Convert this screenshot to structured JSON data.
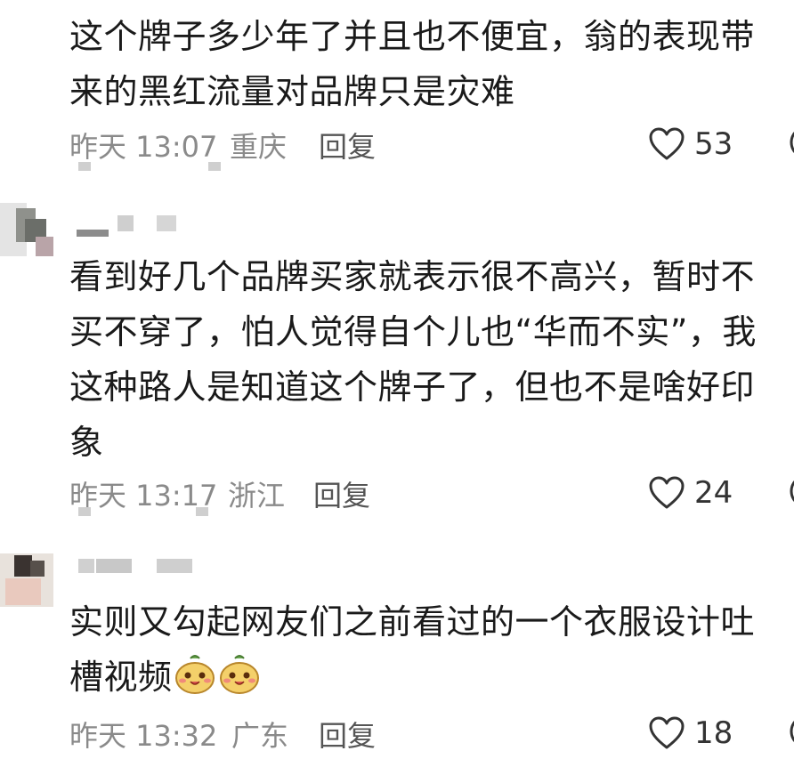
{
  "comments": [
    {
      "text_lines": [
        "这个牌子多少年了并且也不便宜，翁的表现带",
        "来的黑红流量对品牌只是灾难"
      ],
      "time": "昨天 13:07",
      "location": "重庆",
      "reply_label": "回复",
      "likes": "53",
      "like_icon": "heart-outline-icon",
      "dislike_icon": "meh-face-icon"
    },
    {
      "text_lines": [
        "看到好几个品牌买家就表示很不高兴，暂时不",
        "买不穿了，怕人觉得自个儿也“华而不实”，我",
        "这种路人是知道这个牌子了，但也不是啥好印",
        "象"
      ],
      "time": "昨天 13:17",
      "location": "浙江",
      "reply_label": "回复",
      "likes": "24",
      "like_icon": "heart-outline-icon",
      "dislike_icon": "meh-face-icon"
    },
    {
      "text_lines": [
        "实则又勾起网友们之前看过的一个衣服设计吐",
        "槽视频"
      ],
      "emojis": [
        "smiling-creature-emoji",
        "smiling-creature-emoji"
      ],
      "time": "昨天 13:32",
      "location": "广东",
      "reply_label": "回复",
      "likes": "18",
      "like_icon": "heart-outline-icon",
      "dislike_icon": "meh-face-icon"
    }
  ]
}
